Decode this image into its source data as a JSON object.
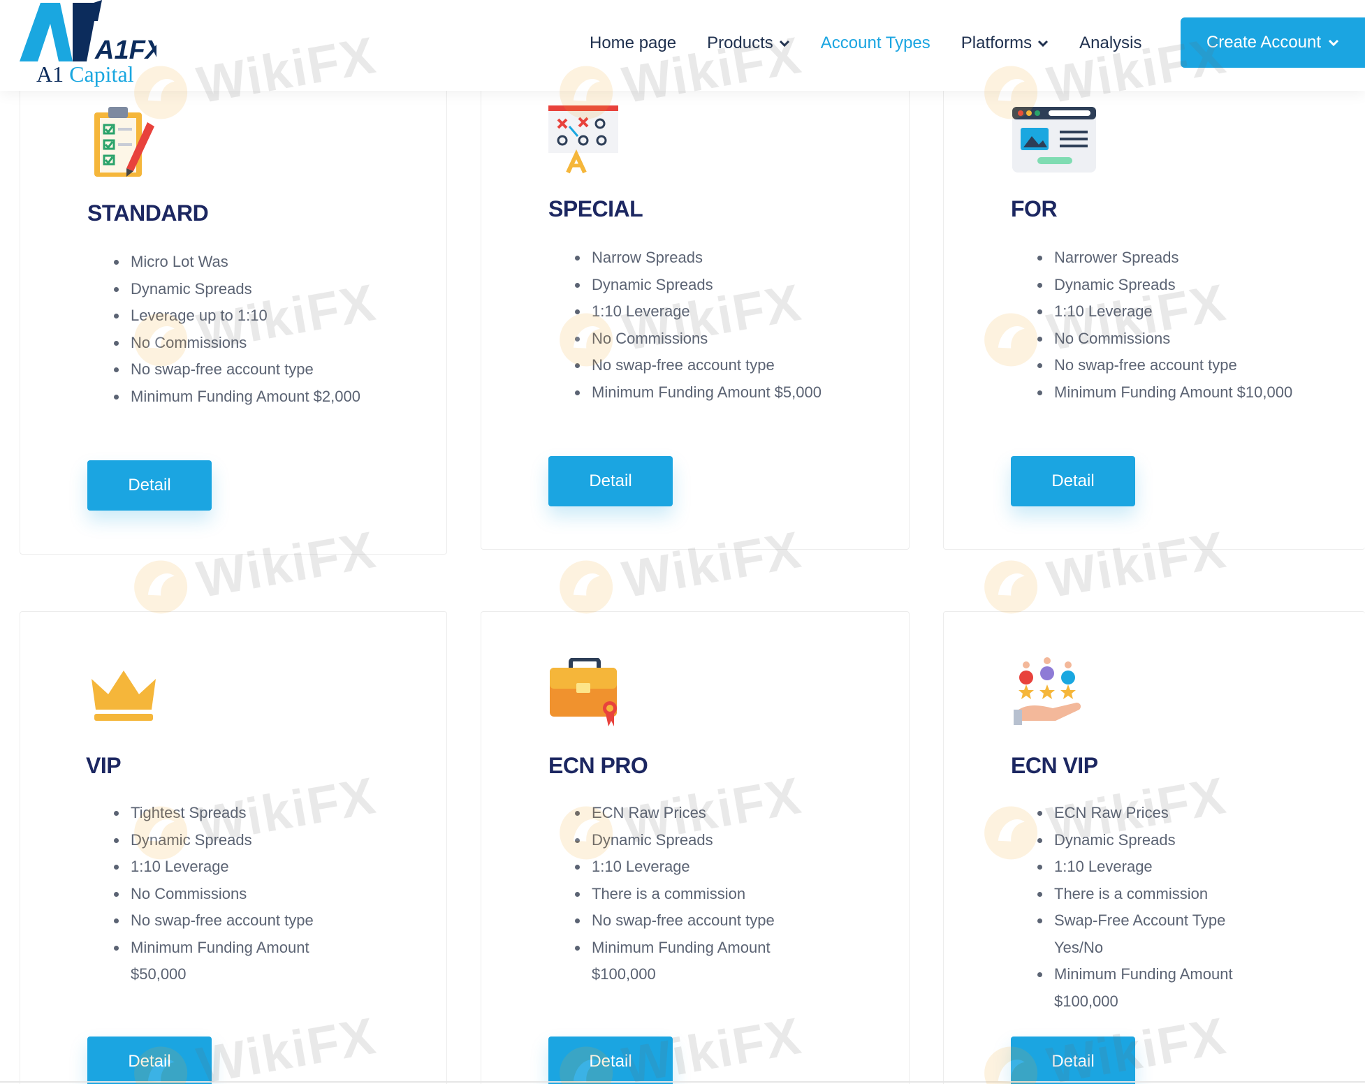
{
  "brand": {
    "logo_mark": "A1FX",
    "logo_name_part1": "A1",
    "logo_name_part2": "Capital"
  },
  "nav": {
    "items": [
      {
        "label": "Home page",
        "dropdown": false,
        "active": false
      },
      {
        "label": "Products",
        "dropdown": true,
        "active": false
      },
      {
        "label": "Account Types",
        "dropdown": false,
        "active": true
      },
      {
        "label": "Platforms",
        "dropdown": true,
        "active": false
      },
      {
        "label": "Analysis",
        "dropdown": false,
        "active": false
      }
    ],
    "cta_label": "Create Account"
  },
  "cards": [
    {
      "title": "STANDARD",
      "icon": "checklist-icon",
      "features": [
        "Micro Lot Was",
        "Dynamic Spreads",
        "Leverage up to 1:10",
        "No Commissions",
        "No swap-free account type",
        "Minimum Funding Amount $2,000"
      ],
      "button": "Detail"
    },
    {
      "title": "SPECIAL",
      "icon": "strategy-board-icon",
      "features": [
        "Narrow Spreads",
        "Dynamic Spreads",
        "1:10 Leverage",
        "No Commissions",
        "No swap-free account type",
        "Minimum Funding Amount $5,000"
      ],
      "button": "Detail"
    },
    {
      "title": "FOR",
      "icon": "browser-window-icon",
      "features": [
        "Narrower Spreads",
        "Dynamic Spreads",
        "1:10 Leverage",
        "No Commissions",
        "No swap-free account type",
        "Minimum Funding Amount $10,000"
      ],
      "button": "Detail"
    },
    {
      "title": "VIP",
      "icon": "crown-icon",
      "features": [
        "Tightest Spreads",
        "Dynamic Spreads",
        "1:10 Leverage",
        "No Commissions",
        "No swap-free account type",
        "Minimum Funding Amount $50,000"
      ],
      "button": "Detail"
    },
    {
      "title": "ECN PRO",
      "icon": "briefcase-icon",
      "features": [
        "ECN Raw Prices",
        "Dynamic Spreads",
        "1:10 Leverage",
        "There is a commission",
        "No swap-free account type",
        "Minimum Funding Amount $100,000"
      ],
      "button": "Detail"
    },
    {
      "title": "ECN VIP",
      "icon": "hand-rating-icon",
      "features": [
        "ECN Raw Prices",
        "Dynamic Spreads",
        "1:10 Leverage",
        "There is a commission",
        "Swap-Free Account Type Yes/No",
        "Minimum Funding Amount $100,000"
      ],
      "button": "Detail"
    }
  ],
  "watermark": {
    "text": "WikiFX"
  },
  "colors": {
    "accent": "#1ba5e1",
    "title": "#1c2761",
    "text": "#5b6373",
    "nav_text": "#20314f"
  }
}
